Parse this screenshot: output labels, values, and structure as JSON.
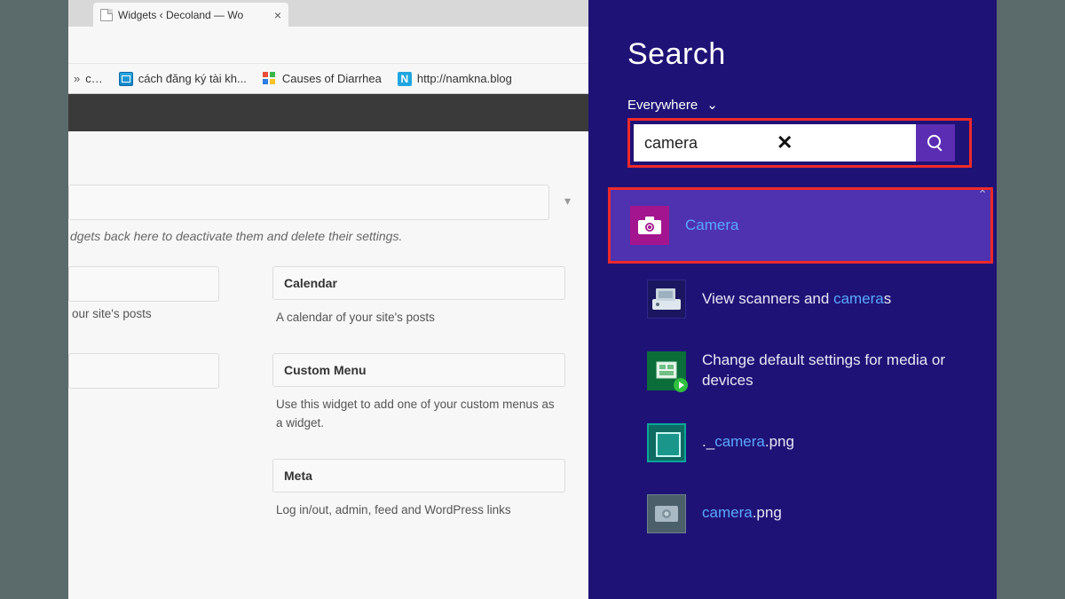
{
  "browser": {
    "tab_title": "Widgets ‹ Decoland — Wo",
    "bookmarks": [
      {
        "label": "c…",
        "icon": "chev"
      },
      {
        "label": "cách đăng ký tài kh...",
        "icon": "box1"
      },
      {
        "label": "Causes of Diarrhea",
        "icon": "grid"
      },
      {
        "label": "http://namkna.blog",
        "icon": "n"
      }
    ]
  },
  "wp": {
    "hint": "dgets back here to deactivate them and delete their settings.",
    "left_desc": "our site's posts",
    "widgets": [
      {
        "title": "Calendar",
        "desc": "A calendar of your site's posts"
      },
      {
        "title": "Custom Menu",
        "desc": "Use this widget to add one of your custom menus as a widget."
      },
      {
        "title": "Meta",
        "desc": "Log in/out, admin, feed and WordPress links"
      }
    ]
  },
  "charm": {
    "heading": "Search",
    "scope": "Everywhere",
    "query": "camera",
    "results": [
      {
        "pre": "",
        "hl": "Camera",
        "post": "",
        "icon": "camera",
        "selected": true
      },
      {
        "pre": "View scanners and ",
        "hl": "camera",
        "post": "s",
        "icon": "scanner"
      },
      {
        "pre": "Change default settings for media or devices",
        "hl": "",
        "post": "",
        "icon": "settings"
      },
      {
        "pre": "._",
        "hl": "camera",
        "post": ".png",
        "icon": "image1"
      },
      {
        "pre": "",
        "hl": "camera",
        "post": ".png",
        "icon": "image2"
      }
    ]
  }
}
